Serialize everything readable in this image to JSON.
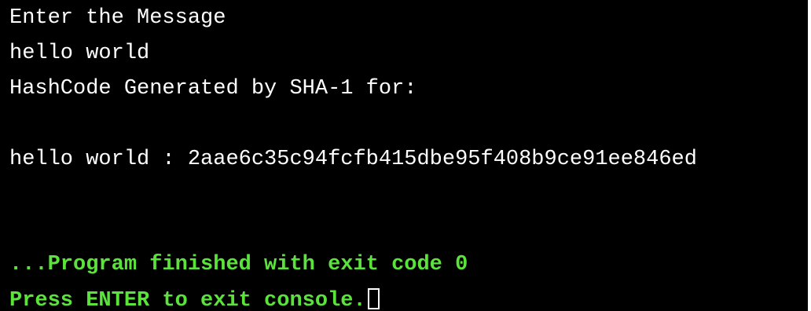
{
  "console": {
    "lines": [
      "Enter the Message",
      "hello world",
      "HashCode Generated by SHA-1 for:",
      "",
      "hello world : 2aae6c35c94fcfb415dbe95f408b9ce91ee846ed"
    ],
    "finish_message": "...Program finished with exit code 0",
    "exit_prompt": "Press ENTER to exit console."
  },
  "colors": {
    "background": "#000000",
    "output_text": "#ffffff",
    "status_text": "#5be33c"
  }
}
